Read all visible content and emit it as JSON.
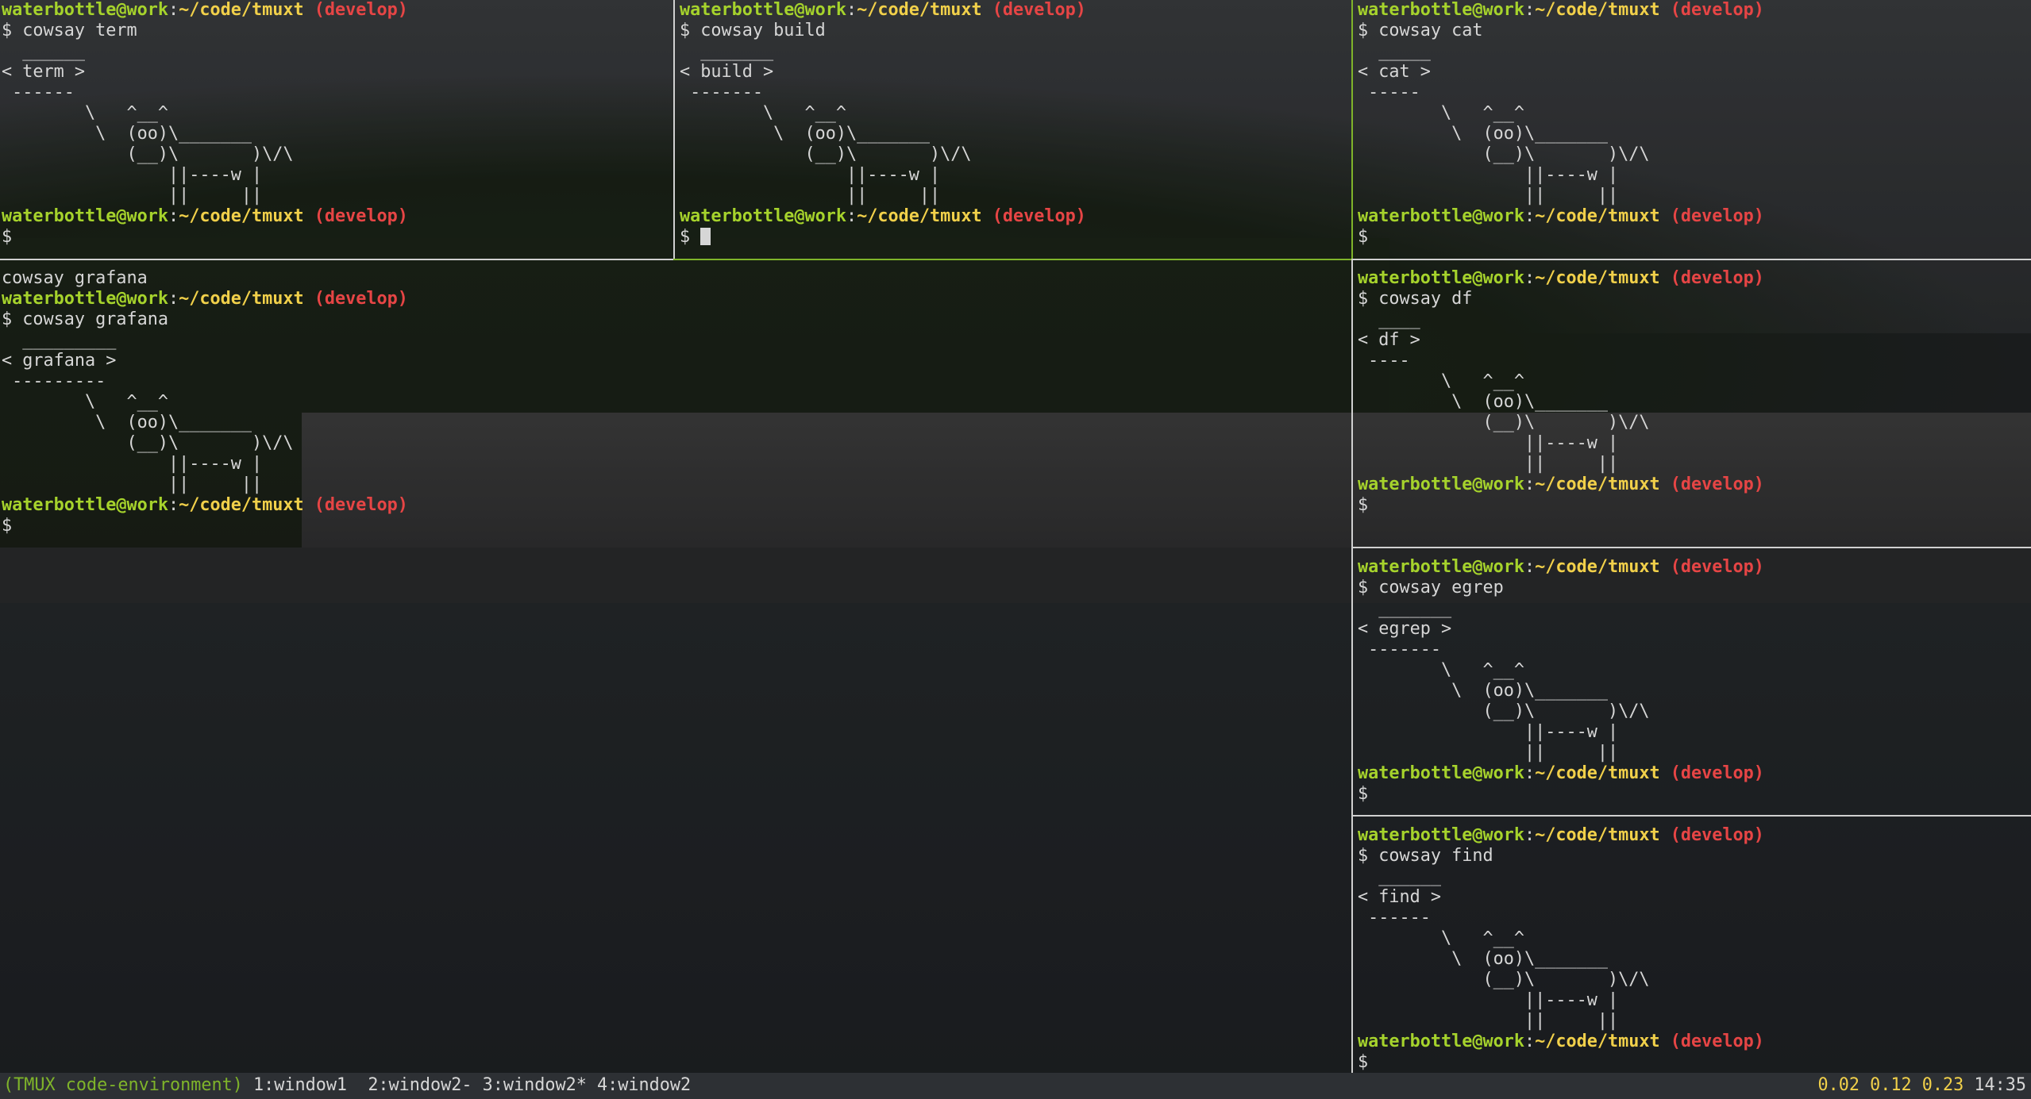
{
  "prompt": {
    "user": "waterbottle",
    "at": "@work",
    "colon": ":",
    "path": "~/code/tmuxt",
    "branch": "(develop)"
  },
  "panes": [
    {
      "name": "pane-term",
      "lines": [
        {
          "type": "prompt"
        },
        {
          "type": "text",
          "text": "$ cowsay term"
        },
        {
          "type": "text",
          "text": "  ______"
        },
        {
          "type": "text",
          "text": "< term >"
        },
        {
          "type": "text",
          "text": " ------"
        },
        {
          "type": "text",
          "text": "        \\   ^__^"
        },
        {
          "type": "text",
          "text": "         \\  (oo)\\_______"
        },
        {
          "type": "text",
          "text": "            (__)\\       )\\/\\"
        },
        {
          "type": "text",
          "text": "                ||----w |"
        },
        {
          "type": "text",
          "text": "                ||     ||"
        },
        {
          "type": "prompt"
        },
        {
          "type": "text",
          "text": "$"
        }
      ]
    },
    {
      "name": "pane-build",
      "lines": [
        {
          "type": "prompt"
        },
        {
          "type": "text",
          "text": "$ cowsay build"
        },
        {
          "type": "text",
          "text": "  _______"
        },
        {
          "type": "text",
          "text": "< build >"
        },
        {
          "type": "text",
          "text": " -------"
        },
        {
          "type": "text",
          "text": "        \\   ^__^"
        },
        {
          "type": "text",
          "text": "         \\  (oo)\\_______"
        },
        {
          "type": "text",
          "text": "            (__)\\       )\\/\\"
        },
        {
          "type": "text",
          "text": "                ||----w |"
        },
        {
          "type": "text",
          "text": "                ||     ||"
        },
        {
          "type": "prompt"
        },
        {
          "type": "cursor",
          "text": "$ "
        }
      ]
    },
    {
      "name": "pane-cat",
      "lines": [
        {
          "type": "prompt"
        },
        {
          "type": "text",
          "text": "$ cowsay cat"
        },
        {
          "type": "text",
          "text": "  _____"
        },
        {
          "type": "text",
          "text": "< cat >"
        },
        {
          "type": "text",
          "text": " -----"
        },
        {
          "type": "text",
          "text": "        \\   ^__^"
        },
        {
          "type": "text",
          "text": "         \\  (oo)\\_______"
        },
        {
          "type": "text",
          "text": "            (__)\\       )\\/\\"
        },
        {
          "type": "text",
          "text": "                ||----w |"
        },
        {
          "type": "text",
          "text": "                ||     ||"
        },
        {
          "type": "prompt"
        },
        {
          "type": "text",
          "text": "$"
        }
      ]
    },
    {
      "name": "pane-grafana",
      "lines": [
        {
          "type": "text",
          "text": "cowsay grafana"
        },
        {
          "type": "prompt"
        },
        {
          "type": "text",
          "text": "$ cowsay grafana"
        },
        {
          "type": "text",
          "text": "  _________"
        },
        {
          "type": "text",
          "text": "< grafana >"
        },
        {
          "type": "text",
          "text": " ---------"
        },
        {
          "type": "text",
          "text": "        \\   ^__^"
        },
        {
          "type": "text",
          "text": "         \\  (oo)\\_______"
        },
        {
          "type": "text",
          "text": "            (__)\\       )\\/\\"
        },
        {
          "type": "text",
          "text": "                ||----w |"
        },
        {
          "type": "text",
          "text": "                ||     ||"
        },
        {
          "type": "prompt"
        },
        {
          "type": "text",
          "text": "$"
        }
      ]
    },
    {
      "name": "pane-df",
      "lines": [
        {
          "type": "prompt"
        },
        {
          "type": "text",
          "text": "$ cowsay df"
        },
        {
          "type": "text",
          "text": "  ____"
        },
        {
          "type": "text",
          "text": "< df >"
        },
        {
          "type": "text",
          "text": " ----"
        },
        {
          "type": "text",
          "text": "        \\   ^__^"
        },
        {
          "type": "text",
          "text": "         \\  (oo)\\_______"
        },
        {
          "type": "text",
          "text": "            (__)\\       )\\/\\"
        },
        {
          "type": "text",
          "text": "                ||----w |"
        },
        {
          "type": "text",
          "text": "                ||     ||"
        },
        {
          "type": "prompt"
        },
        {
          "type": "text",
          "text": "$"
        }
      ]
    },
    {
      "name": "pane-egrep",
      "lines": [
        {
          "type": "prompt"
        },
        {
          "type": "text",
          "text": "$ cowsay egrep"
        },
        {
          "type": "text",
          "text": "  _______"
        },
        {
          "type": "text",
          "text": "< egrep >"
        },
        {
          "type": "text",
          "text": " -------"
        },
        {
          "type": "text",
          "text": "        \\   ^__^"
        },
        {
          "type": "text",
          "text": "         \\  (oo)\\_______"
        },
        {
          "type": "text",
          "text": "            (__)\\       )\\/\\"
        },
        {
          "type": "text",
          "text": "                ||----w |"
        },
        {
          "type": "text",
          "text": "                ||     ||"
        },
        {
          "type": "prompt"
        },
        {
          "type": "text",
          "text": "$"
        }
      ]
    },
    {
      "name": "pane-find",
      "lines": [
        {
          "type": "prompt"
        },
        {
          "type": "text",
          "text": "$ cowsay find"
        },
        {
          "type": "text",
          "text": "  ______"
        },
        {
          "type": "text",
          "text": "< find >"
        },
        {
          "type": "text",
          "text": " ------"
        },
        {
          "type": "text",
          "text": "        \\   ^__^"
        },
        {
          "type": "text",
          "text": "         \\  (oo)\\_______"
        },
        {
          "type": "text",
          "text": "            (__)\\       )\\/\\"
        },
        {
          "type": "text",
          "text": "                ||----w |"
        },
        {
          "type": "text",
          "text": "                ||     ||"
        },
        {
          "type": "prompt"
        },
        {
          "type": "text",
          "text": "$"
        }
      ]
    }
  ],
  "statusbar": {
    "session": "(TMUX code-environment)",
    "windows": [
      "1:window1 ",
      "2:window2-",
      "3:window2*",
      "4:window2"
    ],
    "load": "0.02 0.12 0.23",
    "clock": "14:35"
  },
  "colors": {
    "user": "#a6d32c",
    "path": "#f1d04a",
    "branch": "#e64545",
    "active_border": "#7fb42a",
    "border": "#d0d0d0"
  }
}
